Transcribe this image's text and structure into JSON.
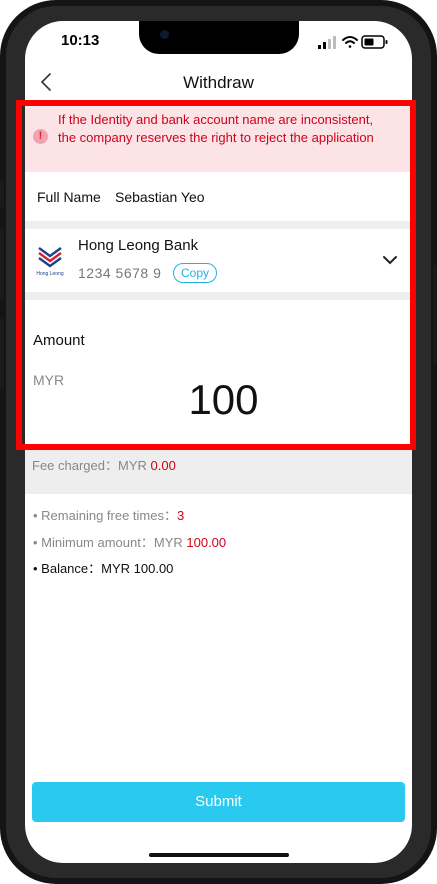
{
  "status_bar": {
    "time": "10:13"
  },
  "nav": {
    "title": "Withdraw"
  },
  "warning": {
    "text": "If the Identity and bank account name are inconsistent, the company reserves the right to reject the application"
  },
  "name": {
    "label": "Full Name",
    "value": "Sebastian Yeo"
  },
  "bank": {
    "name": "Hong Leong Bank",
    "account": "1234 5678 9",
    "copy_label": "Copy",
    "logo_text": "Hong Leong"
  },
  "amount": {
    "label": "Amount",
    "currency": "MYR",
    "value": "100"
  },
  "fee": {
    "label": "Fee charged：MYR ",
    "value": "0.00"
  },
  "info": {
    "remaining_label": "• Remaining free times：",
    "remaining_value": "3",
    "minimum_label": "• Minimum amount：MYR ",
    "minimum_value": "100.00",
    "balance": "• Balance：MYR 100.00"
  },
  "submit": {
    "label": "Submit"
  },
  "colors": {
    "accent": "#29c9f0",
    "error": "#d0021b",
    "highlight": "#ff0000"
  }
}
